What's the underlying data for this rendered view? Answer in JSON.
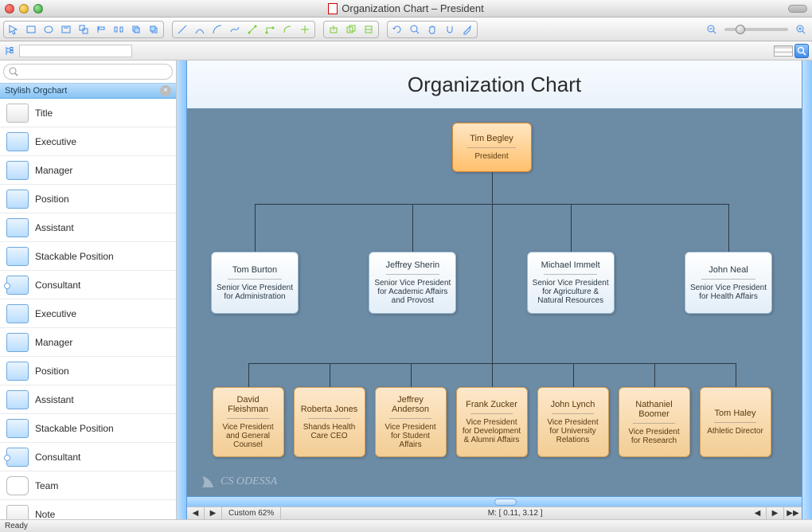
{
  "window": {
    "title": "Organization Chart – President"
  },
  "toolbar_icons": [
    "pointer",
    "rect",
    "ellipse",
    "text-frame",
    "group",
    "align",
    "distribute",
    "forward",
    "back",
    "line",
    "curve",
    "arc",
    "spline",
    "connector-straight",
    "connector-orth",
    "connector-curve",
    "smart",
    "layer-add",
    "layer-dup",
    "layer-opts",
    "rotate",
    "zoom",
    "pan",
    "snap",
    "eyedropper"
  ],
  "zoom_controls": {
    "out": "−",
    "in": "+"
  },
  "sidebar": {
    "search_placeholder": "",
    "panel_title": "Stylish Orgchart",
    "items": [
      {
        "label": "Title",
        "icon": "title"
      },
      {
        "label": "Executive",
        "icon": "box"
      },
      {
        "label": "Manager",
        "icon": "box"
      },
      {
        "label": "Position",
        "icon": "box"
      },
      {
        "label": "Assistant",
        "icon": "box"
      },
      {
        "label": "Stackable Position",
        "icon": "box"
      },
      {
        "label": "Consultant",
        "icon": "consult"
      },
      {
        "label": "Executive",
        "icon": "box"
      },
      {
        "label": "Manager",
        "icon": "box"
      },
      {
        "label": "Position",
        "icon": "box"
      },
      {
        "label": "Assistant",
        "icon": "box"
      },
      {
        "label": "Stackable Position",
        "icon": "box"
      },
      {
        "label": "Consultant",
        "icon": "consult"
      },
      {
        "label": "Team",
        "icon": "team"
      },
      {
        "label": "Note",
        "icon": "title"
      }
    ]
  },
  "chart_data": {
    "type": "tree",
    "title": "Organization Chart",
    "root": {
      "name": "Tim Begley",
      "title": "President",
      "style": "orange"
    },
    "level2": [
      {
        "name": "Tom Burton",
        "title": "Senior Vice President for Administration",
        "style": "blue"
      },
      {
        "name": "Jeffrey Sherin",
        "title": "Senior Vice President for Academic Affairs and Provost",
        "style": "blue"
      },
      {
        "name": "Michael Immelt",
        "title": "Senior Vice President for Agriculture & Natural Resources",
        "style": "blue"
      },
      {
        "name": "John Neal",
        "title": "Senior Vice President for Health Affairs",
        "style": "blue"
      }
    ],
    "level3": [
      {
        "name": "David Fleishman",
        "title": "Vice President and General Counsel",
        "style": "tan"
      },
      {
        "name": "Roberta Jones",
        "title": "Shands Health Care CEO",
        "style": "tan"
      },
      {
        "name": "Jeffrey Anderson",
        "title": "Vice President for Student Affairs",
        "style": "tan"
      },
      {
        "name": "Frank Zucker",
        "title": "Vice President for Development & Alumni Affairs",
        "style": "tan"
      },
      {
        "name": "John Lynch",
        "title": "Vice President for University Relations",
        "style": "tan"
      },
      {
        "name": "Nathaniel Boomer",
        "title": "Vice President for Research",
        "style": "tan"
      },
      {
        "name": "Tom Haley",
        "title": "Athletic Director",
        "style": "tan"
      }
    ]
  },
  "watermark": "CS ODESSA",
  "canvas_status": {
    "nav_prev": "◀",
    "nav_next": "▶",
    "zoom_label": "Custom 62%",
    "coords": "M: [ 0.11, 3.12 ]"
  },
  "status": {
    "text": "Ready"
  }
}
